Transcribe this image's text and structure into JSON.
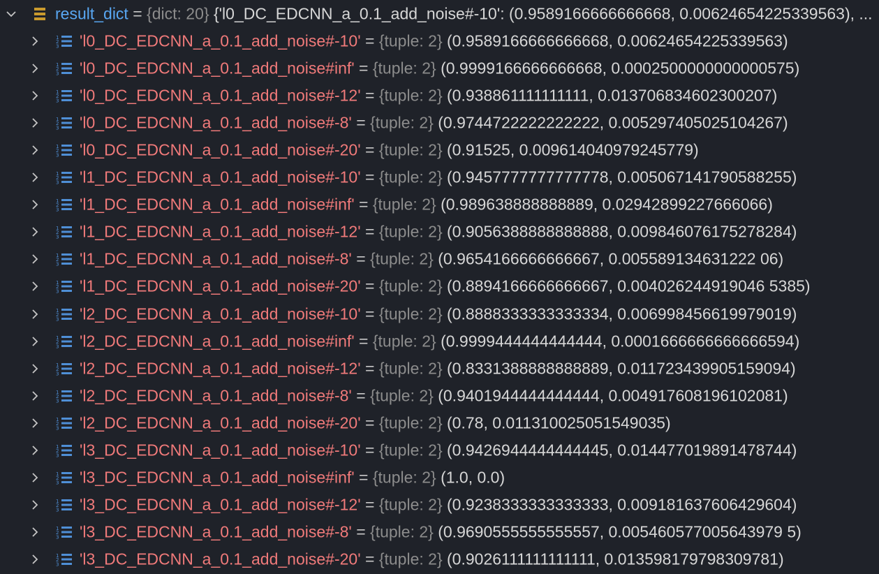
{
  "root": {
    "name": "result_dict",
    "equals": " = ",
    "type_label": "{dict: 20}",
    "preview": "{'l0_DC_EDCNN_a_0.1_add_noise#-10': (0.9589166666666668, 0.00624654225339563), ..."
  },
  "children": [
    {
      "key": "'l0_DC_EDCNN_a_0.1_add_noise#-10'",
      "type_label": "{tuple: 2}",
      "value": "(0.9589166666666668, 0.00624654225339563)"
    },
    {
      "key": "'l0_DC_EDCNN_a_0.1_add_noise#inf'",
      "type_label": "{tuple: 2}",
      "value": "(0.9999166666666668, 0.0002500000000000575)"
    },
    {
      "key": "'l0_DC_EDCNN_a_0.1_add_noise#-12'",
      "type_label": "{tuple: 2}",
      "value": "(0.938861111111111, 0.013706834602300207)"
    },
    {
      "key": "'l0_DC_EDCNN_a_0.1_add_noise#-8'",
      "type_label": "{tuple: 2}",
      "value": "(0.9744722222222222, 0.005297405025104267)"
    },
    {
      "key": "'l0_DC_EDCNN_a_0.1_add_noise#-20'",
      "type_label": "{tuple: 2}",
      "value": "(0.91525, 0.009614040979245779)"
    },
    {
      "key": "'l1_DC_EDCNN_a_0.1_add_noise#-10'",
      "type_label": "{tuple: 2}",
      "value": "(0.9457777777777778, 0.005067141790588255)"
    },
    {
      "key": "'l1_DC_EDCNN_a_0.1_add_noise#inf'",
      "type_label": "{tuple: 2}",
      "value": "(0.989638888888889, 0.02942899227666066)"
    },
    {
      "key": "'l1_DC_EDCNN_a_0.1_add_noise#-12'",
      "type_label": "{tuple: 2}",
      "value": "(0.9056388888888888, 0.009846076175278284)"
    },
    {
      "key": "'l1_DC_EDCNN_a_0.1_add_noise#-8'",
      "type_label": "{tuple: 2}",
      "value": "(0.9654166666666667, 0.005589134631222 06)"
    },
    {
      "key": "'l1_DC_EDCNN_a_0.1_add_noise#-20'",
      "type_label": "{tuple: 2}",
      "value": "(0.8894166666666667, 0.004026244919046 5385)"
    },
    {
      "key": "'l2_DC_EDCNN_a_0.1_add_noise#-10'",
      "type_label": "{tuple: 2}",
      "value": "(0.8888333333333334, 0.006998456619979019)"
    },
    {
      "key": "'l2_DC_EDCNN_a_0.1_add_noise#inf'",
      "type_label": "{tuple: 2}",
      "value": "(0.9999444444444444, 0.0001666666666666594)"
    },
    {
      "key": "'l2_DC_EDCNN_a_0.1_add_noise#-12'",
      "type_label": "{tuple: 2}",
      "value": "(0.8331388888888889, 0.011723439905159094)"
    },
    {
      "key": "'l2_DC_EDCNN_a_0.1_add_noise#-8'",
      "type_label": "{tuple: 2}",
      "value": "(0.9401944444444444, 0.004917608196102081)"
    },
    {
      "key": "'l2_DC_EDCNN_a_0.1_add_noise#-20'",
      "type_label": "{tuple: 2}",
      "value": "(0.78, 0.011310025051549035)"
    },
    {
      "key": "'l3_DC_EDCNN_a_0.1_add_noise#-10'",
      "type_label": "{tuple: 2}",
      "value": "(0.9426944444444445, 0.014477019891478744)"
    },
    {
      "key": "'l3_DC_EDCNN_a_0.1_add_noise#inf'",
      "type_label": "{tuple: 2}",
      "value": "(1.0, 0.0)"
    },
    {
      "key": "'l3_DC_EDCNN_a_0.1_add_noise#-12'",
      "type_label": "{tuple: 2}",
      "value": "(0.9238333333333333, 0.009181637606429604)"
    },
    {
      "key": "'l3_DC_EDCNN_a_0.1_add_noise#-8'",
      "type_label": "{tuple: 2}",
      "value": "(0.9690555555555557, 0.005460577005643979 5)"
    },
    {
      "key": "'l3_DC_EDCNN_a_0.1_add_noise#-20'",
      "type_label": "{tuple: 2}",
      "value": "(0.9026111111111111, 0.013598179798309781)"
    }
  ],
  "icons": {
    "root_expander": "chevron-down-icon",
    "child_expander": "chevron-right-icon",
    "dict_icon": "dict-icon",
    "tuple_icon": "tuple-icon"
  },
  "colors": {
    "background": "#1f2229",
    "variable_name": "#59a7f2",
    "string_key": "#f07a7a",
    "type_label": "#8c8c8c",
    "value_text": "#d6d6d6",
    "dict_icon": "#c99a2e",
    "tuple_icon": "#4f8fd6"
  }
}
